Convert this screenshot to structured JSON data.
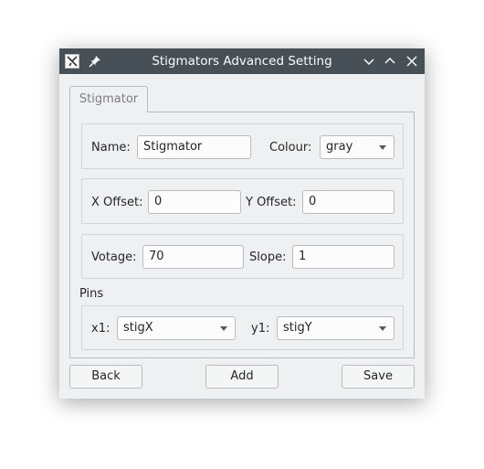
{
  "window": {
    "title": "Stigmators Advanced Setting"
  },
  "tabs": [
    {
      "label": "Stigmator"
    }
  ],
  "form": {
    "name_label": "Name:",
    "name_value": "Stigmator",
    "colour_label": "Colour:",
    "colour_value": "gray",
    "x_offset_label": "X Offset:",
    "x_offset_value": "0",
    "y_offset_label": "Y Offset:",
    "y_offset_value": "0",
    "voltage_label": "Votage:",
    "voltage_value": "70",
    "slope_label": "Slope:",
    "slope_value": "1",
    "pins_label": "Pins",
    "x1_label": "x1:",
    "x1_value": "stigX",
    "y1_label": "y1:",
    "y1_value": "stigY"
  },
  "buttons": {
    "back": "Back",
    "add": "Add",
    "save": "Save"
  }
}
